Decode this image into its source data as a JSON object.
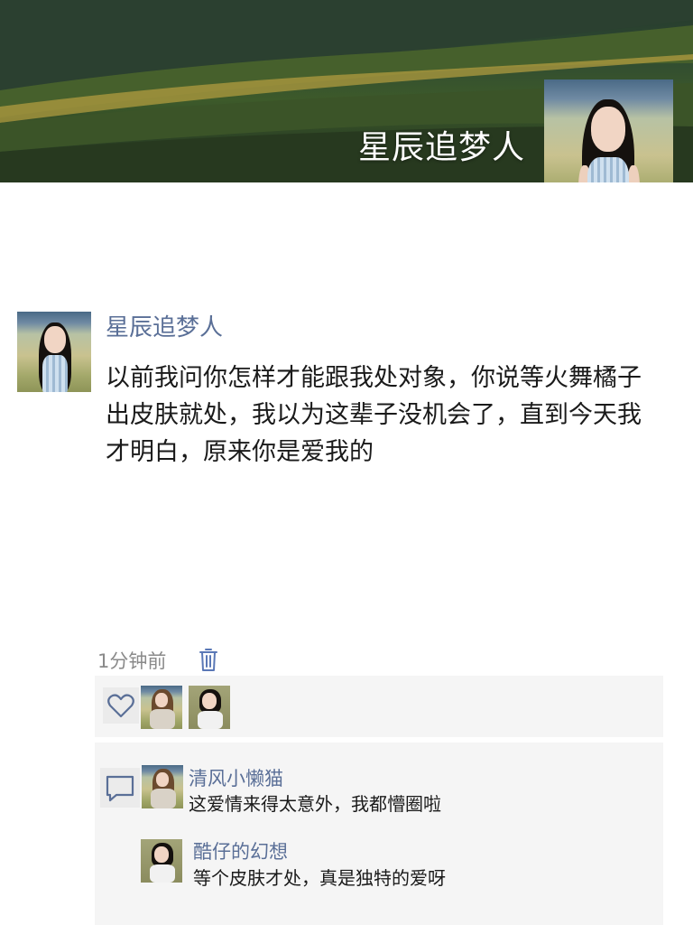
{
  "profile": {
    "name": "星辰追梦人"
  },
  "post": {
    "author": "星辰追梦人",
    "text": "以前我问你怎样才能跟我处对象，你说等火舞橘子出皮肤就处，我以为这辈子没机会了，直到今天我才明白，原来你是爱我的",
    "time": "1分钟前"
  },
  "likes": {
    "icon": "heart-icon",
    "count_avatars": 2
  },
  "comments": [
    {
      "author": "清风小懒猫",
      "text": "这爱情来得太意外，我都懵圈啦"
    },
    {
      "author": "酷仔的幻想",
      "text": "等个皮肤才处，真是独特的爱呀"
    }
  ],
  "colors": {
    "link": "#5a6f97",
    "panel": "#f5f5f5",
    "text": "#1a1a1a",
    "muted": "#8a8a8a"
  }
}
